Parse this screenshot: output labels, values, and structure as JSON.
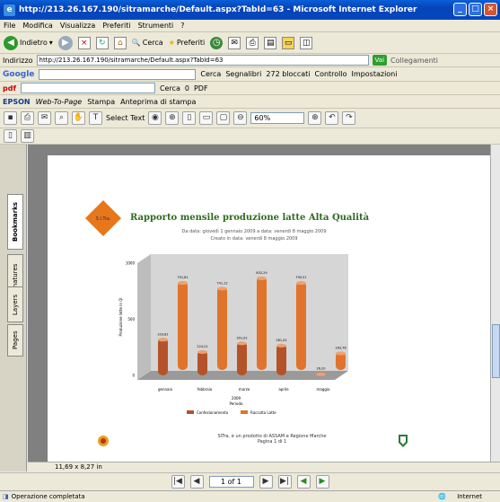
{
  "window": {
    "title": "http://213.26.167.190/sitramarche/Default.aspx?TabId=63 - Microsoft Internet Explorer"
  },
  "menu": [
    "File",
    "Modifica",
    "Visualizza",
    "Preferiti",
    "Strumenti",
    "?"
  ],
  "toolbar": {
    "back": "Indietro",
    "search": "Cerca",
    "favorites": "Preferiti"
  },
  "address": {
    "label": "Indirizzo",
    "url": "http://213.26.167.190/sitramarche/Default.aspx?TabId=63",
    "go": "Vai",
    "links": "Collegamenti"
  },
  "google": {
    "logo": "Google",
    "search": "Cerca",
    "bookmarks": "Segnalibri",
    "blocked": "272 bloccati",
    "check": "Controllo",
    "settings": "Impostazioni"
  },
  "pdfbar": {
    "label": "pdf",
    "search": "Cerca",
    "count": "0",
    "pdf": "PDF"
  },
  "epson": {
    "brand": "EPSON",
    "webtopage": "Web-To-Page",
    "print": "Stampa",
    "preview": "Anteprima di stampa"
  },
  "adobe": {
    "select_text": "Select Text",
    "zoom": "60%"
  },
  "lefttabs": [
    "Bookmarks",
    "Signatures",
    "Layers",
    "Pages"
  ],
  "report": {
    "logo_text": "S.I.Tra.",
    "title": "Rapporto mensile produzione latte Alta Qualità",
    "sub1": "Da data: giovedì 1 gennaio 2009 a data: venerdì 8 maggio 2009",
    "sub2": "Creato in data: venerdì 8 maggio 2009",
    "footer1": "SITra. è un prodotto di ASSAM e Regione Marche",
    "footer2": "Pagina 1 di 1"
  },
  "chart_data": {
    "type": "bar",
    "categories": [
      "gennaio",
      "febbraio",
      "marzo",
      "aprile",
      "maggio"
    ],
    "series": [
      {
        "name": "Confezionamento",
        "values": [
          333.81,
          224.21,
          301.02,
          281.02,
          26.2
        ],
        "color": "#b4532a"
      },
      {
        "name": "Raccolta Latte",
        "values": [
          791.81,
          741.12,
          832.29,
          790.51,
          163.76
        ],
        "color": "#e0742c"
      }
    ],
    "xlabel": "Periodo",
    "xgroup": "2009",
    "ylabel": "Produzione latte in Ql",
    "ylim": [
      0,
      1000
    ],
    "yticks": [
      0,
      500,
      1000
    ],
    "value_labels": [
      "333,81",
      "791,81",
      "224,21",
      "741,12",
      "301,02",
      "832,29",
      "281,02",
      "790,51",
      "26,20",
      "163,76"
    ]
  },
  "docsize": "11,69 x 8,27 in",
  "nav": {
    "page": "1 of 1"
  },
  "status": {
    "left": "Operazione completata",
    "right": "Internet"
  }
}
